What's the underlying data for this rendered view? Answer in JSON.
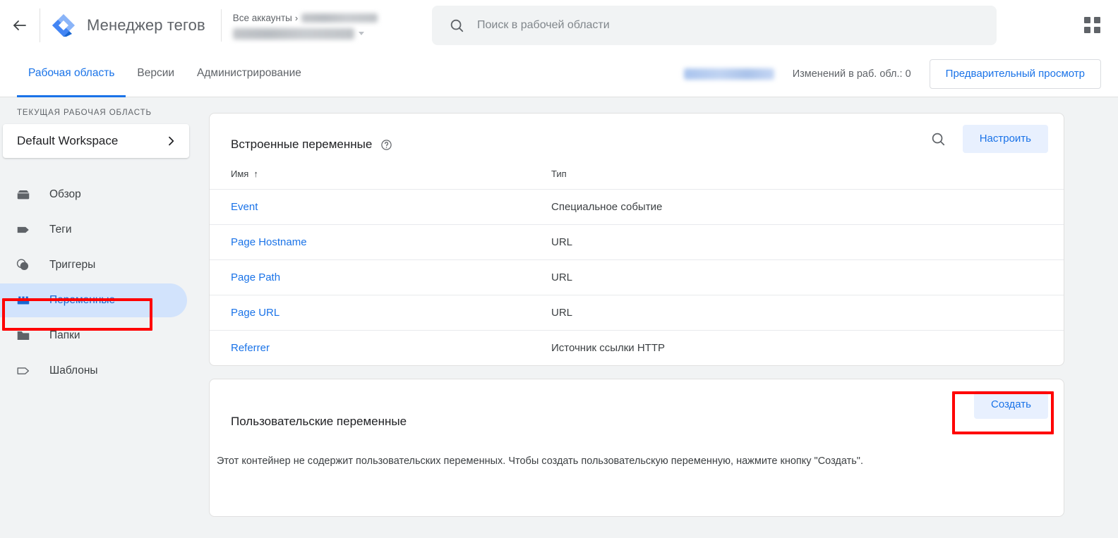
{
  "header": {
    "back_icon": "back-arrow-icon",
    "logo_icon": "google-tag-manager-logo",
    "app_title": "Менеджер тегов",
    "breadcrumb": {
      "all_accounts": "Все аккаунты",
      "separator": "›"
    },
    "search": {
      "placeholder": "Поиск в рабочей области",
      "value": "",
      "icon": "search-icon"
    },
    "apps_icon": "apps-grid-icon"
  },
  "tabbar": {
    "tabs": [
      {
        "label": "Рабочая область",
        "active": true
      },
      {
        "label": "Версии",
        "active": false
      },
      {
        "label": "Администрирование",
        "active": false
      }
    ],
    "changes_label": "Изменений в раб. обл.: 0",
    "preview_label": "Предварительный просмотр"
  },
  "sidebar": {
    "workspace_label": "ТЕКУЩАЯ РАБОЧАЯ ОБЛАСТЬ",
    "workspace_name": "Default Workspace",
    "workspace_chevron": "›",
    "items": [
      {
        "label": "Обзор",
        "icon": "overview-icon",
        "active": false
      },
      {
        "label": "Теги",
        "icon": "tag-icon",
        "active": false
      },
      {
        "label": "Триггеры",
        "icon": "trigger-icon",
        "active": false
      },
      {
        "label": "Переменные",
        "icon": "variable-brick-icon",
        "active": true
      },
      {
        "label": "Папки",
        "icon": "folder-icon",
        "active": false
      },
      {
        "label": "Шаблоны",
        "icon": "template-tag-icon",
        "active": false
      }
    ]
  },
  "main": {
    "builtin_card": {
      "title": "Встроенные переменные",
      "help_icon": "help-circle-icon",
      "search_icon": "search-icon",
      "configure_label": "Настроить",
      "columns": {
        "name": "Имя",
        "sort_arrow": "↑",
        "type": "Тип"
      },
      "rows": [
        {
          "name": "Event",
          "type": "Специальное событие"
        },
        {
          "name": "Page Hostname",
          "type": "URL"
        },
        {
          "name": "Page Path",
          "type": "URL"
        },
        {
          "name": "Page URL",
          "type": "URL"
        },
        {
          "name": "Referrer",
          "type": "Источник ссылки HTTP"
        }
      ]
    },
    "user_card": {
      "title": "Пользовательские переменные",
      "create_label": "Создать",
      "empty_text": "Этот контейнер не содержит пользовательских переменных. Чтобы создать пользовательскую переменную, нажмите кнопку \"Создать\"."
    }
  },
  "annotations": {
    "variables_highlight": "red-rectangle-variables",
    "create_highlight": "red-rectangle-create"
  },
  "colors": {
    "accent_blue": "#1a73e8",
    "active_pill": "#d2e3fc",
    "chip_bg": "#e8f0fe",
    "annotation_red": "#ff0000",
    "page_bg": "#f1f3f4"
  }
}
